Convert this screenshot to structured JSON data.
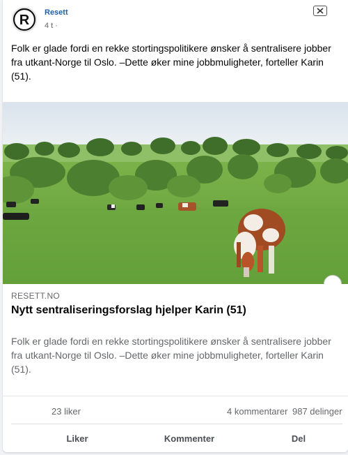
{
  "post": {
    "page_name": "Resett",
    "time": "4 t ·",
    "text": "Folk er glade fordi en rekke stortingspolitikere ønsker å sentralisere jobber fra utkant-Norge til Oslo. –Dette øker mine jobbmuligheter, forteller Karin (51)."
  },
  "link": {
    "domain": "RESETT.NO",
    "title": "Nytt sentraliseringsforslag hjelper Karin (51)",
    "description": "Folk er glade fordi en rekke stortingspolitikere ønsker å sentralisere jobber fra utkant-Norge til Oslo. –Dette øker mine jobbmuligheter, forteller Karin (51)."
  },
  "stats": {
    "likes": "23 liker",
    "comments": "4 kommentarer",
    "shares": "987 delinger"
  },
  "actions": {
    "like": "Liker",
    "comment": "Kommenter",
    "share": "Del"
  },
  "icons": {
    "close": "close-icon",
    "avatar": "resett-logo-icon"
  },
  "colors": {
    "page_name": "#1f5fa8",
    "muted_text": "#65676b"
  }
}
